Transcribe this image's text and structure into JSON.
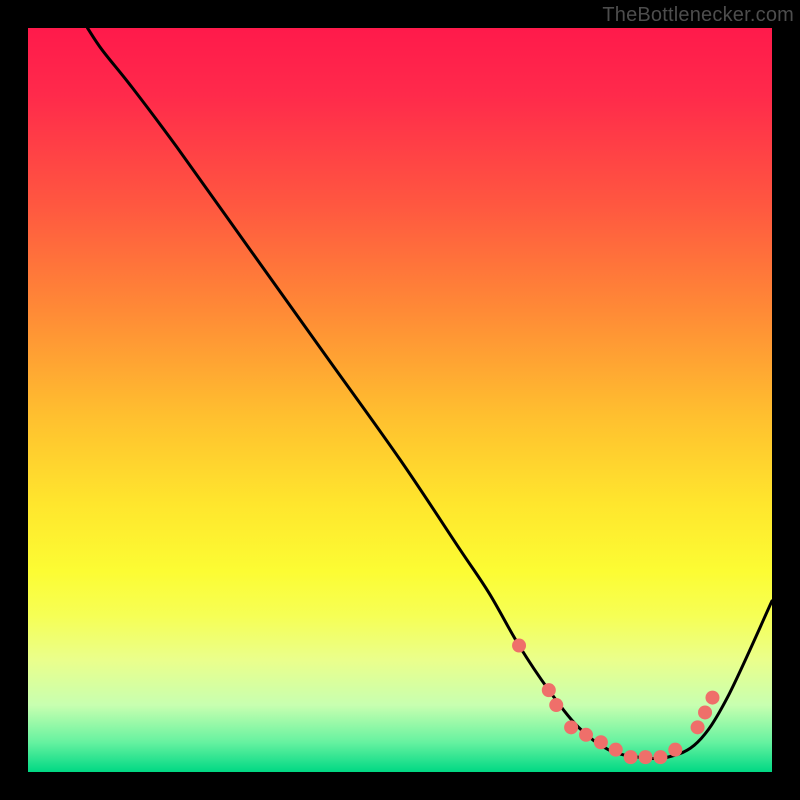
{
  "watermark": "TheBottlenecker.com",
  "chart_data": {
    "type": "line",
    "title": "",
    "xlabel": "",
    "ylabel": "",
    "xlim": [
      0,
      100
    ],
    "ylim": [
      0,
      100
    ],
    "curve": {
      "name": "bottleneck-curve",
      "x": [
        8,
        10,
        14,
        20,
        30,
        40,
        50,
        58,
        62,
        66,
        70,
        74,
        78,
        82,
        86,
        90,
        94,
        100
      ],
      "y": [
        100,
        97,
        92,
        84,
        70,
        56,
        42,
        30,
        24,
        17,
        11,
        6,
        3,
        2,
        2,
        4,
        10,
        23
      ]
    },
    "markers": {
      "name": "highlight-dots",
      "color": "#ef6f6a",
      "radius": 7,
      "points": [
        {
          "x": 66,
          "y": 17
        },
        {
          "x": 70,
          "y": 11
        },
        {
          "x": 71,
          "y": 9
        },
        {
          "x": 73,
          "y": 6
        },
        {
          "x": 75,
          "y": 5
        },
        {
          "x": 77,
          "y": 4
        },
        {
          "x": 79,
          "y": 3
        },
        {
          "x": 81,
          "y": 2
        },
        {
          "x": 83,
          "y": 2
        },
        {
          "x": 85,
          "y": 2
        },
        {
          "x": 87,
          "y": 3
        },
        {
          "x": 90,
          "y": 6
        },
        {
          "x": 91,
          "y": 8
        },
        {
          "x": 92,
          "y": 10
        }
      ]
    }
  }
}
